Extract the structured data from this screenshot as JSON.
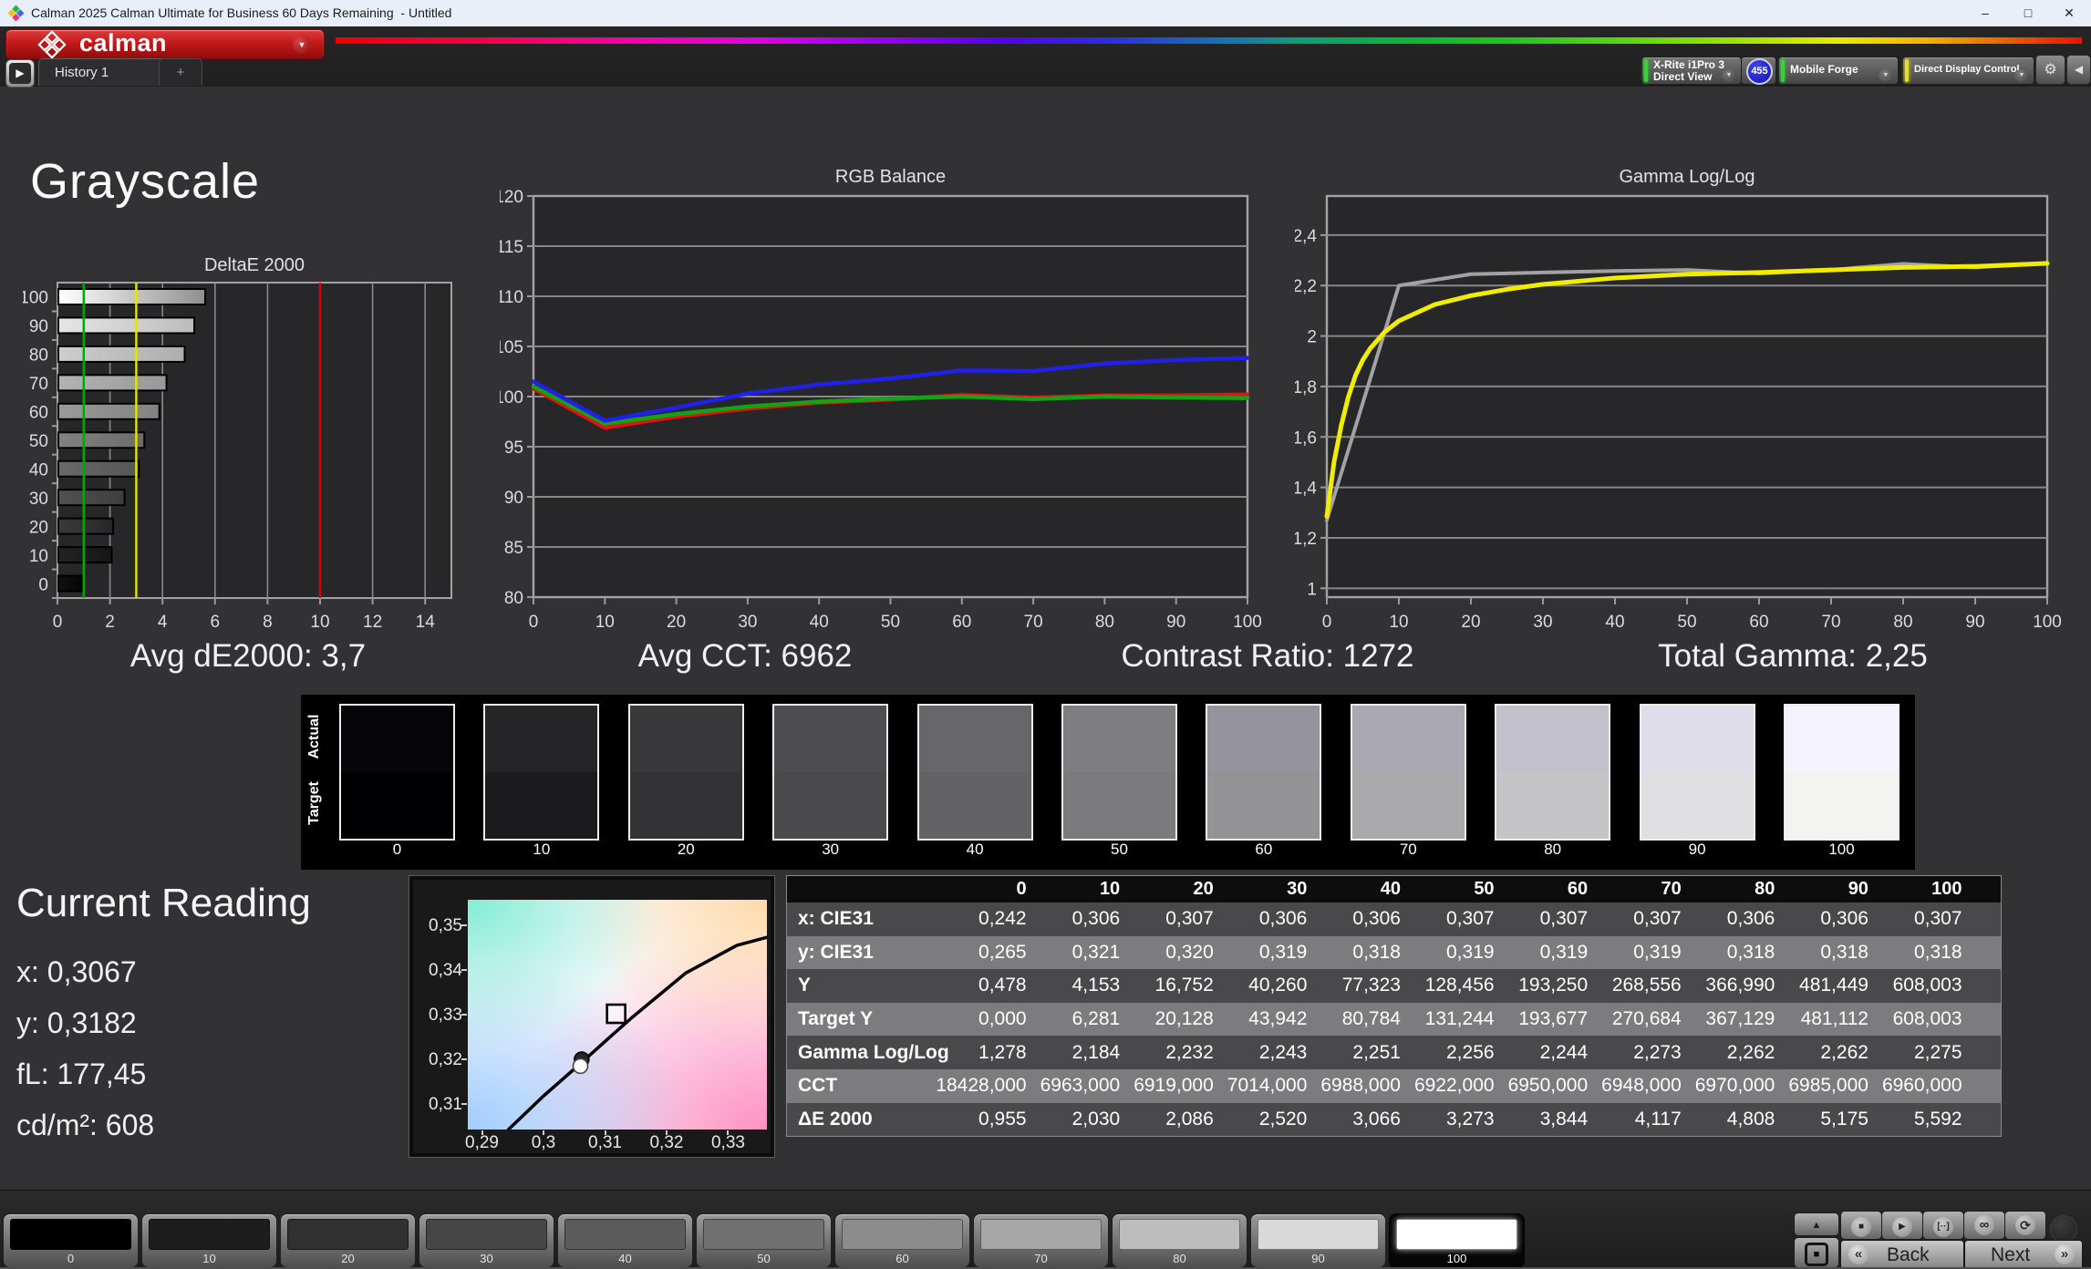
{
  "window": {
    "title": "Calman 2025 Calman Ultimate for Business 60 Days Remaining  - Untitled",
    "minimize": "–",
    "maximize": "□",
    "close": "✕"
  },
  "toolbar": {
    "logo_label": "calman",
    "nav_arrow": "▶",
    "history_tab": "History 1",
    "add_tab": "+",
    "dropdown_icon": "▼",
    "gear_icon": "⚙",
    "collapse_icon": "◀",
    "devices": [
      {
        "line1": "X-Rite i1Pro 3",
        "line2": "Direct View",
        "accent": "#35d435",
        "badge": "455"
      },
      {
        "line1": "Mobile Forge",
        "line2": "",
        "accent": "#35d435"
      },
      {
        "line1": "Direct Display Control",
        "line2": "",
        "accent": "#e3de2b"
      }
    ]
  },
  "page": {
    "heading": "Grayscale"
  },
  "stats": [
    "Avg dE2000: 3,7",
    "Avg CCT: 6962",
    "Contrast Ratio: 1272",
    "Total Gamma: 2,25"
  ],
  "chart_data": [
    {
      "id": "deltae",
      "type": "bar",
      "orientation": "horizontal",
      "title": "DeltaE 2000",
      "categories": [
        "100",
        "90",
        "80",
        "70",
        "60",
        "50",
        "40",
        "30",
        "20",
        "10",
        "0"
      ],
      "values": [
        5.592,
        5.175,
        4.808,
        4.117,
        3.844,
        3.273,
        3.066,
        2.52,
        2.086,
        2.03,
        0.955
      ],
      "xlim": [
        0,
        15
      ],
      "xticks": [
        0,
        2,
        4,
        6,
        8,
        10,
        12,
        14
      ],
      "grid": true,
      "bar_colors": [
        [
          "#ffffff",
          "#8f8f8f"
        ],
        [
          "#e6e6e6",
          "#bcbcbc"
        ],
        [
          "#cdcdcd",
          "#aeaeae"
        ],
        [
          "#b3b3b3",
          "#989898"
        ],
        [
          "#9a9a9a",
          "#828282"
        ],
        [
          "#818181",
          "#6c6c6c"
        ],
        [
          "#696969",
          "#565656"
        ],
        [
          "#515151",
          "#3e3e3e"
        ],
        [
          "#3a3a3a",
          "#272727"
        ],
        [
          "#232323",
          "#151515"
        ],
        [
          "#101010",
          "#040404"
        ]
      ],
      "reference_lines": [
        {
          "value": 1,
          "color": "#00a800"
        },
        {
          "value": 3,
          "color": "#e8e200"
        },
        {
          "value": 10,
          "color": "#dc0000"
        }
      ]
    },
    {
      "id": "rgb-balance",
      "type": "line",
      "title": "RGB Balance",
      "x": [
        0,
        10,
        20,
        30,
        40,
        50,
        60,
        70,
        80,
        90,
        100
      ],
      "xticks": [
        0,
        10,
        20,
        30,
        40,
        50,
        60,
        70,
        80,
        90,
        100
      ],
      "ylim": [
        80,
        120
      ],
      "yticks": [
        80,
        85,
        90,
        95,
        100,
        105,
        110,
        115,
        120
      ],
      "ytick_labels": [
        "80",
        "85",
        "90",
        "95",
        "100",
        "105",
        "110",
        "115",
        "120"
      ],
      "grid": true,
      "legend": "none",
      "series": [
        {
          "name": "Red",
          "color": "#e11212",
          "width": 4.5,
          "values": [
            100.8,
            96.9,
            98.0,
            98.8,
            99.4,
            99.7,
            100.15,
            99.9,
            100.1,
            100.1,
            100.2
          ]
        },
        {
          "name": "Green",
          "color": "#12a412",
          "width": 4.5,
          "values": [
            101.0,
            97.3,
            98.25,
            99.0,
            99.5,
            99.8,
            100.0,
            99.75,
            100.0,
            99.9,
            99.85
          ]
        },
        {
          "name": "Blue",
          "color": "#2020e8",
          "width": 4.5,
          "values": [
            101.5,
            97.6,
            98.9,
            100.3,
            101.2,
            101.8,
            102.6,
            102.55,
            103.3,
            103.65,
            103.85
          ]
        }
      ]
    },
    {
      "id": "gamma",
      "type": "line",
      "title": "Gamma Log/Log",
      "x": [
        0,
        10,
        20,
        30,
        40,
        50,
        60,
        70,
        80,
        90,
        100
      ],
      "xticks": [
        0,
        10,
        20,
        30,
        40,
        50,
        60,
        70,
        80,
        90,
        100
      ],
      "ylim": [
        0.965,
        2.555
      ],
      "yticks": [
        1,
        1.2,
        1.4,
        1.6,
        1.8,
        2,
        2.2,
        2.4
      ],
      "ytick_labels": [
        "1",
        "1,2",
        "1,4",
        "1,6",
        "1,8",
        "2",
        "2,2",
        "2,4"
      ],
      "grid": true,
      "legend": "none",
      "series": [
        {
          "name": "Target gamma",
          "color": "#a2a2a2",
          "width": 4,
          "values": [
            1.27,
            2.2,
            2.245,
            2.252,
            2.258,
            2.262,
            2.248,
            2.262,
            2.286,
            2.272,
            2.288
          ]
        },
        {
          "name": "Measured gamma",
          "color": "#f2ec00",
          "width": 5,
          "x": [
            0,
            1,
            2,
            3,
            4,
            5,
            6,
            8,
            10,
            15,
            20,
            25,
            30,
            40,
            50,
            60,
            70,
            80,
            90,
            100
          ],
          "values": [
            1.285,
            1.5,
            1.645,
            1.76,
            1.845,
            1.905,
            1.95,
            2.015,
            2.06,
            2.125,
            2.16,
            2.185,
            2.205,
            2.23,
            2.245,
            2.252,
            2.262,
            2.272,
            2.276,
            2.288
          ]
        }
      ]
    },
    {
      "id": "cie-xy",
      "type": "scatter",
      "title": "CIE xy chromaticity (white point)",
      "xlim": [
        0.2877,
        0.3363
      ],
      "ylim": [
        0.3043,
        0.3557
      ],
      "xticks": [
        0.29,
        0.3,
        0.31,
        0.32,
        0.33
      ],
      "xtick_labels": [
        "0,29",
        "0,3",
        "0,31",
        "0,32",
        "0,33"
      ],
      "yticks": [
        0.31,
        0.32,
        0.33,
        0.34,
        0.35
      ],
      "ytick_labels": [
        "0,31",
        "0,32",
        "0,33",
        "0,34",
        "0,35"
      ],
      "locus": [
        [
          0.2943,
          0.3043
        ],
        [
          0.3,
          0.3118
        ],
        [
          0.3062,
          0.3193
        ],
        [
          0.3104,
          0.3245
        ],
        [
          0.3145,
          0.3295
        ],
        [
          0.3231,
          0.3393
        ],
        [
          0.3314,
          0.3455
        ],
        [
          0.3363,
          0.3473
        ]
      ],
      "markers": [
        {
          "name": "target-whitepoint",
          "shape": "square",
          "x": 0.3118,
          "y": 0.3302
        },
        {
          "name": "reading-previous",
          "shape": "circle",
          "fill": "#242424",
          "x": 0.3062,
          "y": 0.32
        },
        {
          "name": "reading-current",
          "shape": "circle",
          "fill": "#fcfcfc",
          "x": 0.306,
          "y": 0.3185
        }
      ]
    }
  ],
  "swatch_strip": {
    "row_labels": [
      "Actual",
      "Target"
    ],
    "levels": [
      "0",
      "10",
      "20",
      "30",
      "40",
      "50",
      "60",
      "70",
      "80",
      "90",
      "100"
    ],
    "actual_colors": [
      "#06060a",
      "#252527",
      "#39393b",
      "#4e4e52",
      "#67676b",
      "#7e7e82",
      "#95949c",
      "#aaa9b2",
      "#c2c1cb",
      "#dedde9",
      "#f5f3fe"
    ],
    "target_colors": [
      "#010104",
      "#1b1b1d",
      "#333335",
      "#4a4a4c",
      "#636365",
      "#7b7b7d",
      "#939396",
      "#aaaaac",
      "#c4c3c5",
      "#e0dfe1",
      "#f3f3f1"
    ]
  },
  "current_reading": {
    "heading": "Current Reading",
    "values": [
      "x: 0,3067",
      "y: 0,3182",
      "fL: 177,45",
      "cd/m²: 608"
    ]
  },
  "table": {
    "columns": [
      "0",
      "10",
      "20",
      "30",
      "40",
      "50",
      "60",
      "70",
      "80",
      "90",
      "100"
    ],
    "rows": [
      {
        "label": "x: CIE31",
        "values": [
          "0,242",
          "0,306",
          "0,307",
          "0,306",
          "0,306",
          "0,307",
          "0,307",
          "0,307",
          "0,306",
          "0,306",
          "0,307"
        ]
      },
      {
        "label": "y: CIE31",
        "values": [
          "0,265",
          "0,321",
          "0,320",
          "0,319",
          "0,318",
          "0,319",
          "0,319",
          "0,319",
          "0,318",
          "0,318",
          "0,318"
        ]
      },
      {
        "label": "Y",
        "values": [
          "0,478",
          "4,153",
          "16,752",
          "40,260",
          "77,323",
          "128,456",
          "193,250",
          "268,556",
          "366,990",
          "481,449",
          "608,003"
        ]
      },
      {
        "label": "Target Y",
        "values": [
          "0,000",
          "6,281",
          "20,128",
          "43,942",
          "80,784",
          "131,244",
          "193,677",
          "270,684",
          "367,129",
          "481,112",
          "608,003"
        ]
      },
      {
        "label": "Gamma Log/Log",
        "values": [
          "1,278",
          "2,184",
          "2,232",
          "2,243",
          "2,251",
          "2,256",
          "2,244",
          "2,273",
          "2,262",
          "2,262",
          "2,275"
        ]
      },
      {
        "label": "CCT",
        "values": [
          "18428,000",
          "6963,000",
          "6919,000",
          "7014,000",
          "6988,000",
          "6922,000",
          "6950,000",
          "6948,000",
          "6970,000",
          "6985,000",
          "6960,000"
        ]
      },
      {
        "label": "ΔE 2000",
        "values": [
          "0,955",
          "2,030",
          "2,086",
          "2,520",
          "3,066",
          "3,273",
          "3,844",
          "4,117",
          "4,808",
          "5,175",
          "5,592"
        ]
      }
    ]
  },
  "bottom_bar": {
    "patches": [
      {
        "label": "0",
        "color": "#000000"
      },
      {
        "label": "10",
        "color": "#1d1d1d"
      },
      {
        "label": "20",
        "color": "#313131"
      },
      {
        "label": "30",
        "color": "#464646"
      },
      {
        "label": "40",
        "color": "#5b5b5b"
      },
      {
        "label": "50",
        "color": "#707070"
      },
      {
        "label": "60",
        "color": "#8c8c8c"
      },
      {
        "label": "70",
        "color": "#a6a6a6"
      },
      {
        "label": "80",
        "color": "#bdbdbd"
      },
      {
        "label": "90",
        "color": "#d9d9d9"
      },
      {
        "label": "100",
        "color": "#ffffff",
        "selected": true
      }
    ],
    "transport_icons": [
      {
        "name": "up",
        "glyph": "▲"
      },
      {
        "name": "stop-square",
        "glyph": "■"
      },
      {
        "name": "stop",
        "glyph": "■"
      },
      {
        "name": "play",
        "glyph": "▶"
      },
      {
        "name": "single-measure",
        "glyph": "[··]"
      },
      {
        "name": "continuous",
        "glyph": "∞"
      },
      {
        "name": "refresh",
        "glyph": "⟳"
      }
    ],
    "back_chevron": "«",
    "back_label": "Back",
    "next_label": "Next",
    "next_chevron": "»"
  }
}
